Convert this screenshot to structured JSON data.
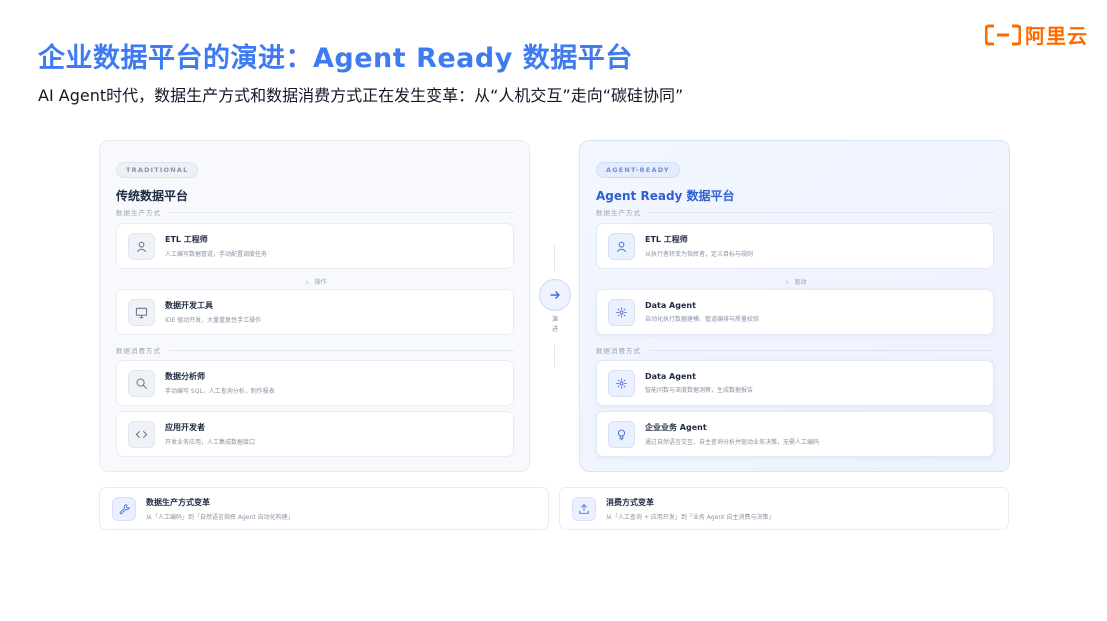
{
  "header": {
    "title": "企业数据平台的演进：Agent Ready 数据平台",
    "subtitle": "AI Agent时代，数据生产方式和数据消费方式正在发生变革：从“人机交互”走向“碳硅协同”",
    "logo_text": "阿里云"
  },
  "colors": {
    "accent": "#3e7bf0",
    "brand": "#ff6a00"
  },
  "traditional": {
    "tag": "TRADITIONAL",
    "title": "传统数据平台",
    "production_label": "数据生产方式",
    "consumption_label": "数据消费方式",
    "connector": "操作",
    "cards": [
      {
        "icon": "user-icon",
        "title": "ETL 工程师",
        "desc": "人工编写数据管道，手动配置调度任务"
      },
      {
        "icon": "monitor-icon",
        "title": "数据开发工具",
        "desc": "IDE 驱动开发，大量重复性手工操作"
      },
      {
        "icon": "search-icon",
        "title": "数据分析师",
        "desc": "手动编写 SQL，人工查询分析，制作报表"
      },
      {
        "icon": "code-icon",
        "title": "应用开发者",
        "desc": "开发业务应用，人工集成数据接口"
      }
    ]
  },
  "middle": {
    "label_1": "演",
    "label_2": "进"
  },
  "agent_ready": {
    "tag": "AGENT-READY",
    "title": "Agent Ready 数据平台",
    "production_label": "数据生产方式",
    "consumption_label": "数据消费方式",
    "connector": "驱动",
    "cards": [
      {
        "icon": "user-icon",
        "title": "ETL 工程师",
        "desc": "从执行者转变为指挥者，定义目标与规则"
      },
      {
        "icon": "spark-icon",
        "title": "Data Agent",
        "desc": "自动化执行数据建模、管道编排与质量校验"
      },
      {
        "icon": "spark-icon",
        "title": "Data Agent",
        "desc": "智能问数与深度数据洞察，生成数据报告"
      },
      {
        "icon": "bulb-icon",
        "title": "企业业务 Agent",
        "desc": "通过自然语言交互，自主查询分析并驱动业务决策，无需人工编码"
      }
    ]
  },
  "bottom": [
    {
      "icon": "wrench-icon",
      "title": "数据生产方式变革",
      "desc": "从「人工编码」到「自然语言指挥 Agent 自动化构建」"
    },
    {
      "icon": "upload-icon",
      "title": "消费方式变革",
      "desc": "从「人工查询 + 应用开发」到「业务 Agent 自主消费与决策」"
    }
  ]
}
